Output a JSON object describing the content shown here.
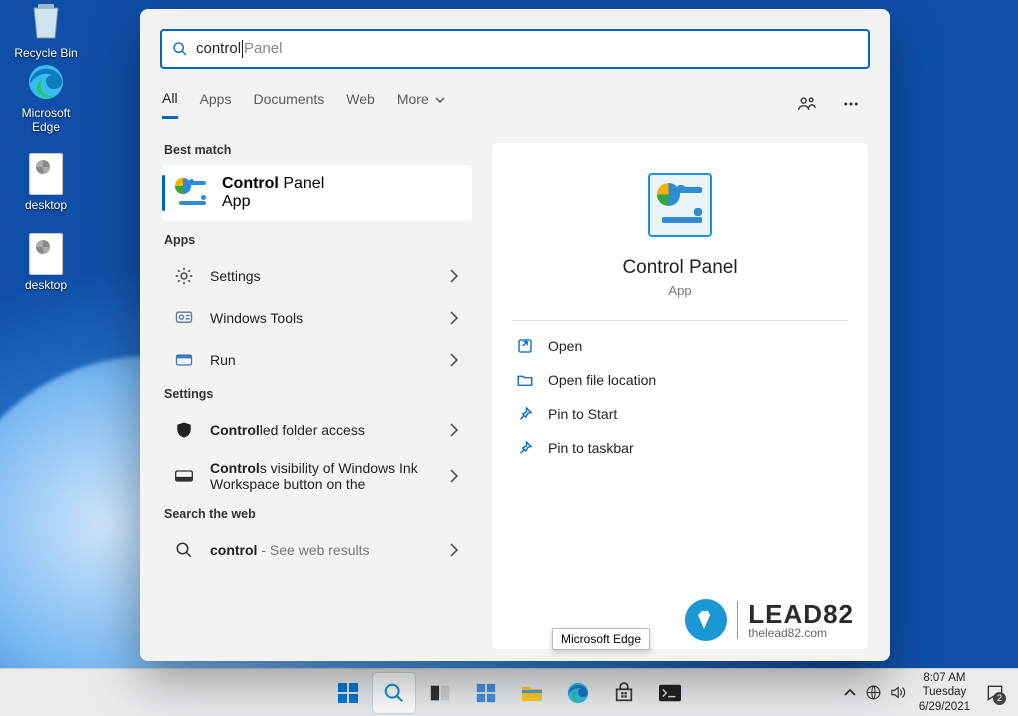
{
  "desktop": {
    "recycle": "Recycle Bin",
    "edge": "Microsoft Edge",
    "file1": "desktop",
    "file2": "desktop"
  },
  "search": {
    "typed": "control",
    "suggestion": " Panel",
    "tabs": {
      "all": "All",
      "apps": "Apps",
      "documents": "Documents",
      "web": "Web",
      "more": "More"
    },
    "headers": {
      "best": "Best match",
      "apps": "Apps",
      "settings": "Settings",
      "web": "Search the web"
    },
    "best": {
      "bold": "Control",
      "rest": " Panel",
      "sub": "App"
    },
    "apps": [
      "Settings",
      "Windows Tools",
      "Run"
    ],
    "settings": {
      "s1_bold": "Control",
      "s1_rest": "led folder access",
      "s2_bold": "Control",
      "s2_rest": "s visibility of Windows Ink Workspace button on the"
    },
    "webrow": {
      "bold": "control",
      "rest": " - See web results"
    }
  },
  "preview": {
    "title": "Control Panel",
    "sub": "App",
    "actions": [
      "Open",
      "Open file location",
      "Pin to Start",
      "Pin to taskbar"
    ]
  },
  "watermark": {
    "brand": "LEAD82",
    "site": "thelead82.com"
  },
  "tooltip": "Microsoft Edge",
  "clock": {
    "time": "8:07 AM",
    "day": "Tuesday",
    "date": "6/29/2021",
    "notif_count": "2"
  }
}
